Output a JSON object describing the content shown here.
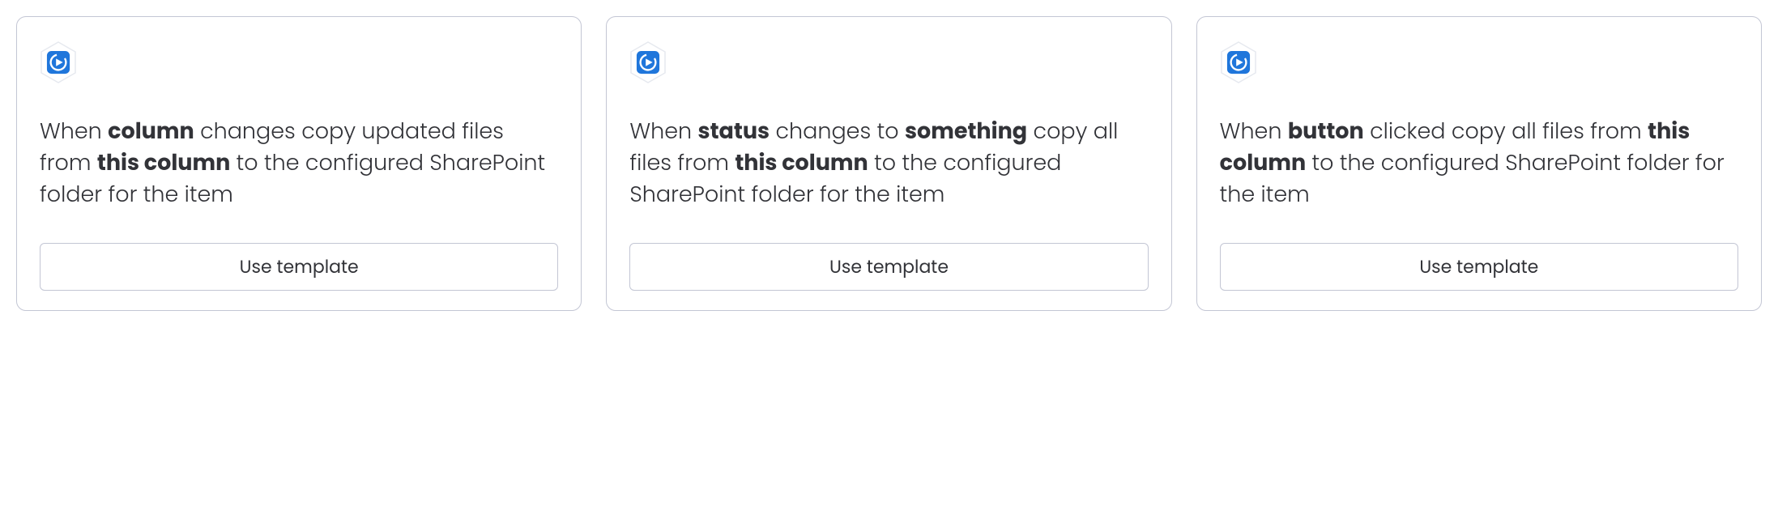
{
  "icon_name": "sharepoint-icon",
  "icon_color": "#1f76db",
  "button_label": "Use template",
  "cards": [
    {
      "parts": {
        "p0": "When ",
        "b0": "column",
        "p1": " changes copy updated files from ",
        "b1": "this column",
        "p2": " to the configured SharePoint folder for the item"
      }
    },
    {
      "parts": {
        "p0": "When ",
        "b0": "status",
        "p1": " changes to ",
        "b1": "something",
        "p2": " copy all files from ",
        "b2": "this column",
        "p3": " to the configured SharePoint folder for the item"
      }
    },
    {
      "parts": {
        "p0": "When ",
        "b0": "button",
        "p1": " clicked copy all files from ",
        "b1": "this column",
        "p2": " to the configured SharePoint folder for the item"
      }
    }
  ]
}
